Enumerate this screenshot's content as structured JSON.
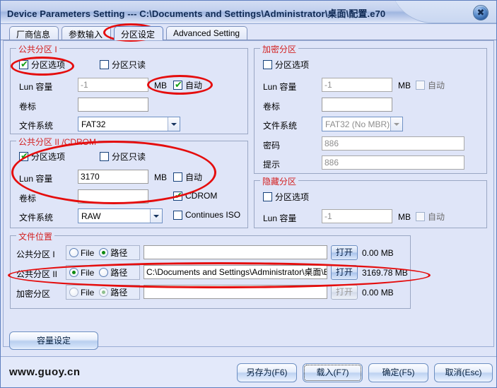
{
  "window": {
    "title": "Device Parameters Setting --- C:\\Documents and Settings\\Administrator\\桌面\\配置.e70",
    "close_label": "✖"
  },
  "tabs": [
    {
      "label": "厂商信息",
      "active": false
    },
    {
      "label": "参数输入",
      "active": false
    },
    {
      "label": "分区设定",
      "active": true
    },
    {
      "label": "Advanced Setting",
      "active": false
    }
  ],
  "public_partition_1": {
    "legend": "公共分区 I",
    "opt_checkbox": {
      "label": "分区选项",
      "checked": true,
      "enabled": true
    },
    "readonly_checkbox": {
      "label": "分区只读",
      "checked": false,
      "enabled": true
    },
    "lun_label": "Lun 容量",
    "lun_value": "-1",
    "mb_label": "MB",
    "auto_checkbox": {
      "label": "自动",
      "checked": true,
      "enabled": true
    },
    "volume_label": "卷标",
    "volume_value": "",
    "fs_label": "文件系统",
    "fs_value": "FAT32"
  },
  "public_partition_2": {
    "legend": "公共分区 II /CDROM",
    "opt_checkbox": {
      "label": "分区选项",
      "checked": true,
      "enabled": true
    },
    "readonly_checkbox": {
      "label": "分区只读",
      "checked": false,
      "enabled": true
    },
    "lun_label": "Lun 容量",
    "lun_value": "3170",
    "mb_label": "MB",
    "auto_checkbox": {
      "label": "自动",
      "checked": false,
      "enabled": true
    },
    "volume_label": "卷标",
    "volume_value": "",
    "cdrom_checkbox": {
      "label": "CDROM",
      "checked": true,
      "enabled": true
    },
    "fs_label": "文件系统",
    "fs_value": "RAW",
    "continues_iso_checkbox": {
      "label": "Continues ISO",
      "checked": false,
      "enabled": true
    }
  },
  "encrypted_partition": {
    "legend": "加密分区",
    "opt_checkbox": {
      "label": "分区选项",
      "checked": false,
      "enabled": true
    },
    "lun_label": "Lun 容量",
    "lun_value": "-1",
    "mb_label": "MB",
    "auto_checkbox": {
      "label": "自动",
      "checked": false,
      "enabled": false
    },
    "volume_label": "卷标",
    "volume_value": "",
    "fs_label": "文件系统",
    "fs_value": "FAT32 (No MBR)",
    "password_label": "密码",
    "password_value": "886",
    "hint_label": "提示",
    "hint_value": "886"
  },
  "hidden_partition": {
    "legend": "隐藏分区",
    "opt_checkbox": {
      "label": "分区选项",
      "checked": false,
      "enabled": true
    },
    "lun_label": "Lun 容量",
    "lun_value": "-1",
    "mb_label": "MB",
    "auto_checkbox": {
      "label": "自动",
      "checked": false,
      "enabled": false
    }
  },
  "file_location": {
    "legend": "文件位置",
    "file_option_label": "File",
    "path_option_label": "路径",
    "open_button_label": "打开",
    "rows": [
      {
        "label": "公共分区 I",
        "mode": "path",
        "path": "",
        "size": "0.00 MB",
        "open_enabled": true
      },
      {
        "label": "公共分区 II",
        "mode": "file",
        "path": "C:\\Documents and Settings\\Administrator\\桌面\\Ed",
        "size": "3169.78 MB",
        "open_enabled": true
      },
      {
        "label": "加密分区",
        "mode": "path",
        "path": "",
        "size": "0.00 MB",
        "open_enabled": false
      }
    ]
  },
  "capacity_button_label": "容量设定",
  "footer": {
    "brand": "www.guoy.cn",
    "buttons": [
      {
        "label": "另存为(F6)",
        "focused": false
      },
      {
        "label": "载入(F7)",
        "focused": true
      },
      {
        "label": "确定(F5)",
        "focused": false
      },
      {
        "label": "取消(Esc)",
        "focused": false
      }
    ]
  },
  "annotation_color": "#e50d0d"
}
